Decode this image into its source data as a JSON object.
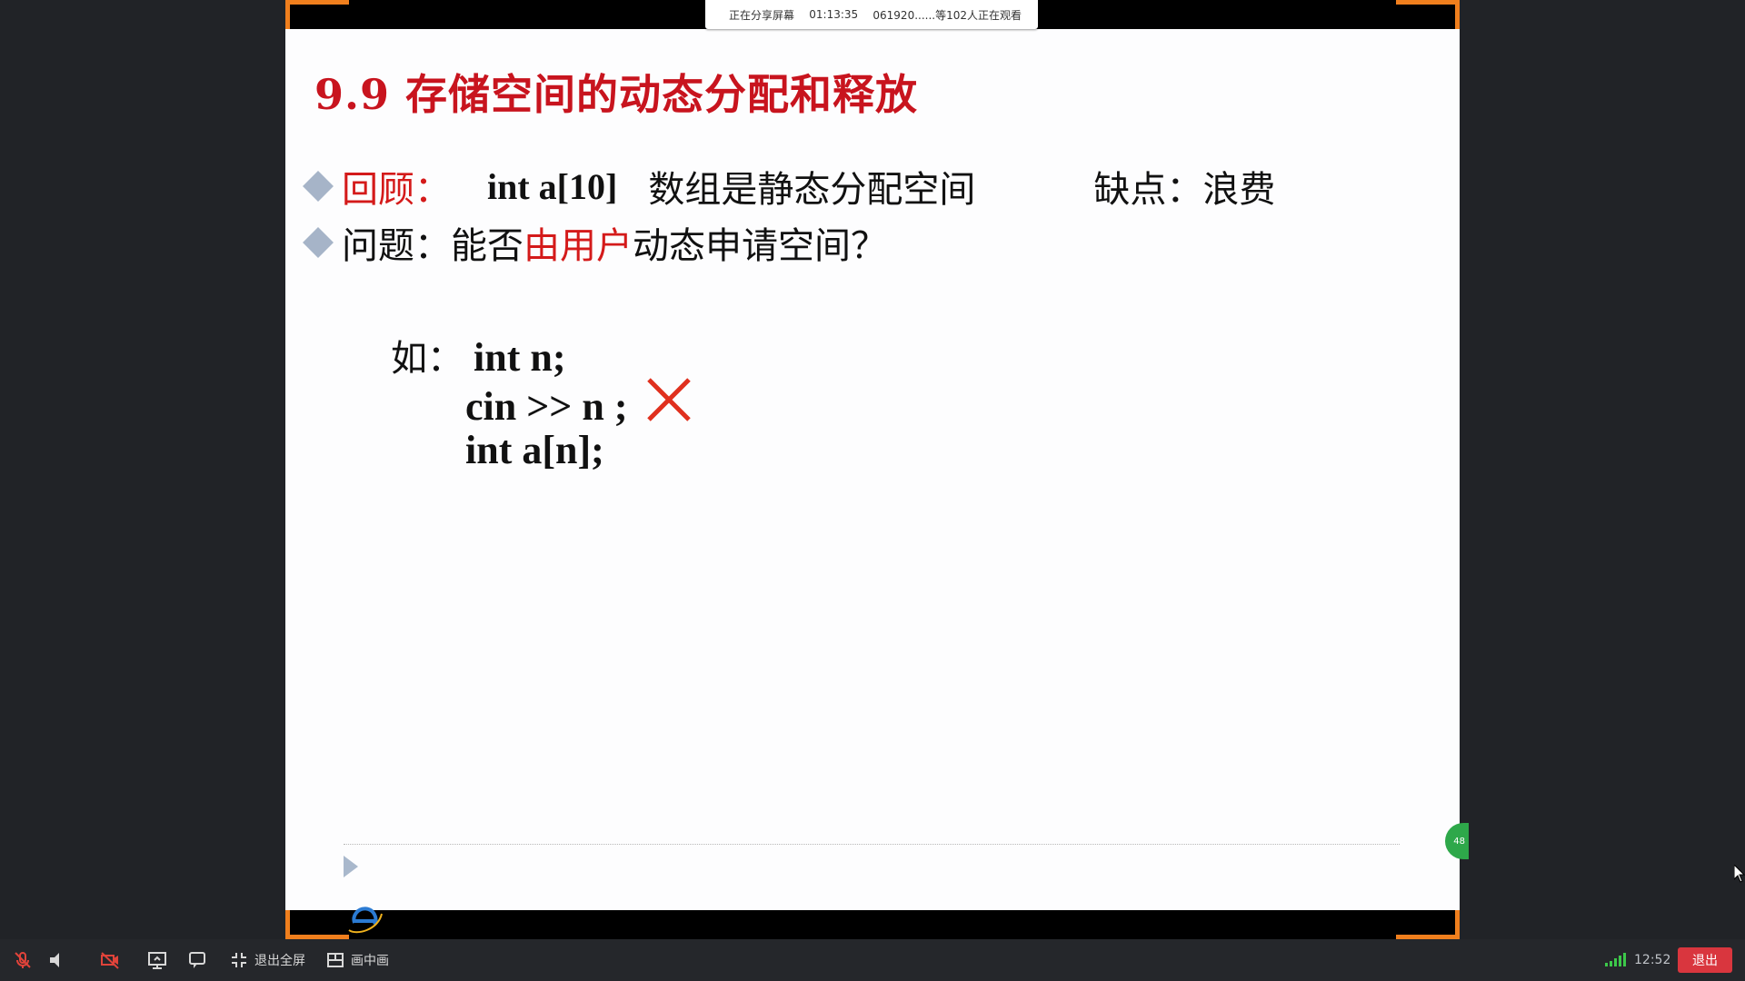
{
  "share_bar": {
    "status": "正在分享屏幕",
    "elapsed": "01:13:35",
    "viewers": "061920......等102人正在观看"
  },
  "slide": {
    "title": "9.9 存储空间的动态分配和释放",
    "row1": {
      "label": "回顾：",
      "code": "int a[10]",
      "text": "数组是静态分配空间",
      "drawback": "缺点：浪费"
    },
    "row2": {
      "prefix": "问题：能否",
      "highlight": "由用户",
      "suffix": "动态申请空间？"
    },
    "example": {
      "prefix": "如：",
      "line1": "int n;",
      "line2": "cin >> n ;",
      "line3": "int a[n];"
    },
    "badge": "48"
  },
  "toolbar": {
    "exit_fullscreen_label": "退出全屏",
    "pip_label": "画中画",
    "clock": "12:52",
    "exit_label": "退出"
  },
  "colors": {
    "accent_orange": "#f07f1d",
    "title_red": "#c8141e",
    "exit_red": "#d9363e",
    "signal_green": "#3cc84a"
  }
}
